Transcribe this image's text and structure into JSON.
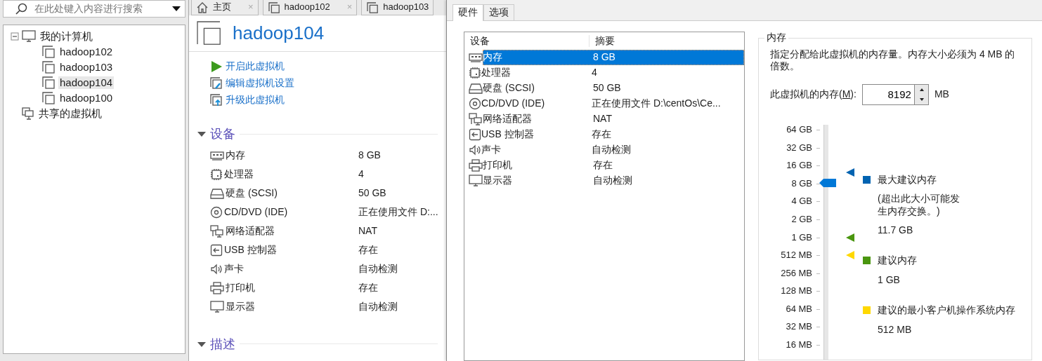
{
  "library": {
    "search": {
      "placeholder": "在此处键入内容进行搜索"
    },
    "tree": [
      {
        "label": "我的计算机",
        "expanded": true,
        "selected": false,
        "children": [
          {
            "label": "hadoop102",
            "selected": false
          },
          {
            "label": "hadoop103",
            "selected": false
          },
          {
            "label": "hadoop104",
            "selected": true
          },
          {
            "label": "hadoop100",
            "selected": false
          }
        ]
      },
      {
        "label": "共享的虚拟机",
        "selected": false
      }
    ]
  },
  "tabs": [
    {
      "label": "主页",
      "close": "×",
      "selected": false
    },
    {
      "label": "hadoop102",
      "close": "×",
      "selected": false
    },
    {
      "label": "hadoop103",
      "selected": false
    }
  ],
  "vm": {
    "title": "hadoop104",
    "actions": [
      "开启此虚拟机",
      "编辑虚拟机设置",
      "升级此虚拟机"
    ],
    "sections": [
      {
        "title": "设备",
        "expanded": true,
        "devices": [
          {
            "name": "内存",
            "summary": "8 GB"
          },
          {
            "name": "处理器",
            "summary": "4"
          },
          {
            "name": "硬盘 (SCSI)",
            "summary": "50 GB"
          },
          {
            "name": "CD/DVD (IDE)",
            "summary": "正在使用文件 D:..."
          },
          {
            "name": "网络适配器",
            "summary": "NAT"
          },
          {
            "name": "USB 控制器",
            "summary": "存在"
          },
          {
            "name": "声卡",
            "summary": "自动检测"
          },
          {
            "name": "打印机",
            "summary": "存在"
          },
          {
            "name": "显示器",
            "summary": "自动检测"
          }
        ]
      },
      {
        "title": "描述",
        "expanded": true
      }
    ]
  },
  "settings": {
    "tabs": [
      {
        "label": "硬件",
        "selected": true
      },
      {
        "label": "选项",
        "selected": false
      }
    ],
    "device_table": {
      "columns": [
        "设备",
        "摘要"
      ],
      "rows": [
        {
          "device": "内存",
          "summary": "8 GB",
          "selected": true
        },
        {
          "device": "处理器",
          "summary": "4",
          "selected": false
        },
        {
          "device": "硬盘 (SCSI)",
          "summary": "50 GB",
          "selected": false
        },
        {
          "device": "CD/DVD (IDE)",
          "summary": "正在使用文件 D:\\centOs\\Ce...",
          "selected": false
        },
        {
          "device": "网络适配器",
          "summary": "NAT",
          "selected": false
        },
        {
          "device": "USB 控制器",
          "summary": "存在",
          "selected": false
        },
        {
          "device": "声卡",
          "summary": "自动检测",
          "selected": false
        },
        {
          "device": "打印机",
          "summary": "存在",
          "selected": false
        },
        {
          "device": "显示器",
          "summary": "自动检测",
          "selected": false
        }
      ]
    },
    "memory": {
      "title": "内存",
      "description": "指定分配给此虚拟机的内存量。内存大小必须为 4 MB 的倍数。",
      "field": {
        "label_before": "此虚拟机的内存(",
        "mnemonic": "M",
        "label_after": "):",
        "value": "8192",
        "unit": "MB"
      },
      "slider": {
        "level": 0.752,
        "ticks": [
          "64 GB",
          "32 GB",
          "16 GB",
          "8 GB",
          "4 GB",
          "2 GB",
          "1 GB",
          "512 MB",
          "256 MB",
          "128 MB",
          "64 MB",
          "32 MB",
          "16 MB"
        ]
      },
      "legend": [
        {
          "label": "最大建议内存",
          "note": "(超出此大小可能发生内存交换。)",
          "value": "11.7 GB",
          "color": "#0063b1",
          "level": 0.8
        },
        {
          "label": "建议内存",
          "value": "1 GB",
          "color": "#4a960f",
          "level": 0.5
        },
        {
          "label": "建议的最小客户机操作系统内存",
          "value": "512 MB",
          "color": "#ffd800",
          "level": 0.417
        }
      ]
    }
  }
}
